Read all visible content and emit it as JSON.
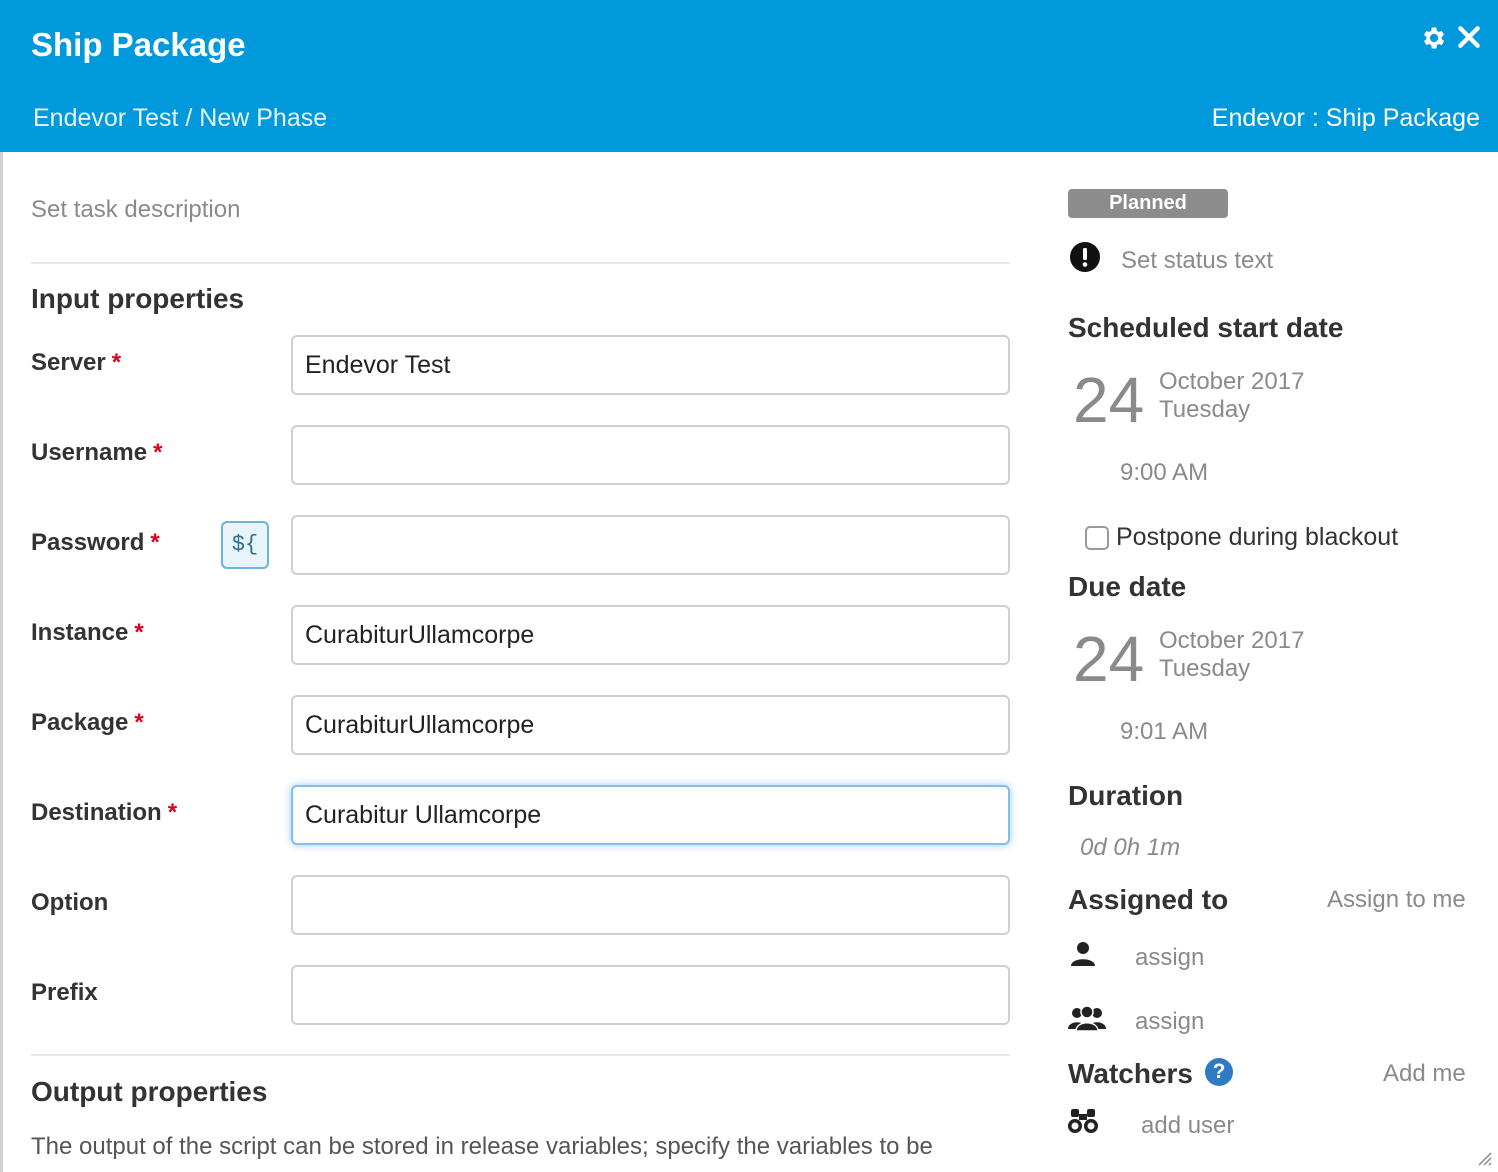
{
  "header": {
    "title": "Ship Package",
    "breadcrumb": "Endevor Test / New Phase",
    "task_type": "Endevor : Ship Package"
  },
  "task": {
    "description_placeholder": "Set task description"
  },
  "input_properties": {
    "title": "Input properties",
    "required_marker": "*",
    "variable_button": "${",
    "fields": {
      "server": {
        "label": "Server",
        "value": "Endevor Test"
      },
      "username": {
        "label": "Username",
        "value": ""
      },
      "password": {
        "label": "Password",
        "value": ""
      },
      "instance": {
        "label": "Instance",
        "value": "CurabiturUllamcorpe"
      },
      "package": {
        "label": "Package",
        "value": "CurabiturUllamcorpe"
      },
      "destination": {
        "label": "Destination",
        "value": "Curabitur Ullamcorpe"
      },
      "option": {
        "label": "Option",
        "value": ""
      },
      "prefix": {
        "label": "Prefix",
        "value": ""
      }
    }
  },
  "output_properties": {
    "title": "Output properties",
    "description": "The output of the script can be stored in release variables; specify the variables to be"
  },
  "sidebar": {
    "status": "Planned",
    "status_text_placeholder": "Set status text",
    "scheduled_start": {
      "heading": "Scheduled start date",
      "day": "24",
      "month_year": "October 2017",
      "weekday": "Tuesday",
      "time": "9:00 AM"
    },
    "postpone_label": "Postpone during blackout",
    "postpone_checked": false,
    "due_date": {
      "heading": "Due date",
      "day": "24",
      "month_year": "October 2017",
      "weekday": "Tuesday",
      "time": "9:01 AM"
    },
    "duration": {
      "heading": "Duration",
      "value": "0d 0h 1m"
    },
    "assigned_to": {
      "heading": "Assigned to",
      "assign_to_me": "Assign to me",
      "user_assign": "assign",
      "team_assign": "assign"
    },
    "watchers": {
      "heading": "Watchers",
      "help": "?",
      "add_me": "Add me",
      "add_user": "add user"
    }
  },
  "colors": {
    "header_bg": "#0099db",
    "required": "#e0001b",
    "status_badge": "#8c8c8c",
    "help_icon": "#2e7ac3"
  }
}
